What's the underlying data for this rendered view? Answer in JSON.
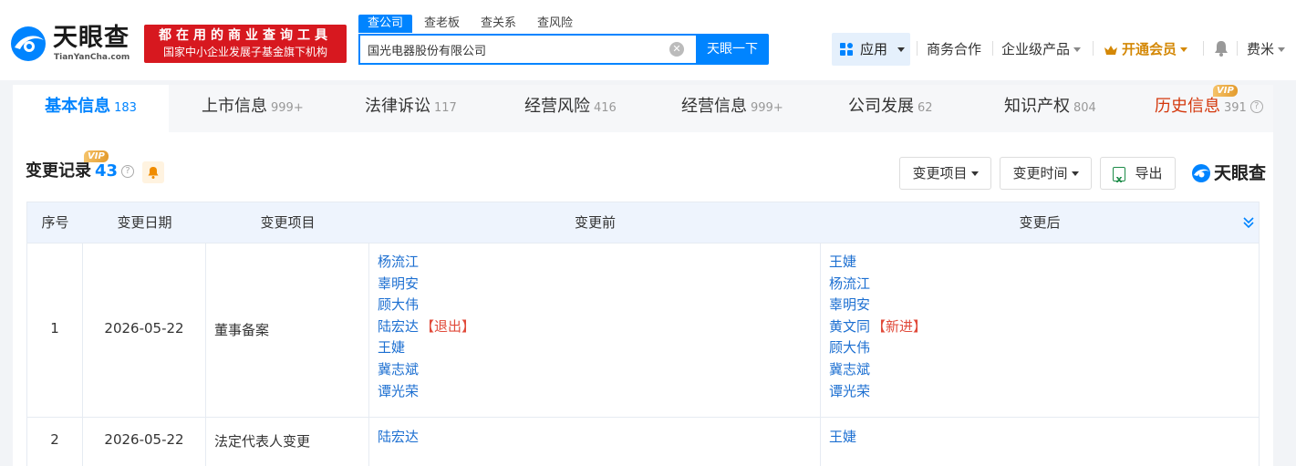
{
  "header": {
    "logo_cn": "天眼查",
    "logo_en": "TianYanCha.com",
    "slogan_line1": "都在用的商业查询工具",
    "slogan_line2": "国家中小企业发展子基金旗下机构",
    "search_tabs": [
      "查公司",
      "查老板",
      "查关系",
      "查风险"
    ],
    "search_value": "国光电器股份有限公司",
    "search_button": "天眼一下",
    "nav": {
      "apps": "应用",
      "business": "商务合作",
      "enterprise": "企业级产品",
      "vip": "开通会员",
      "user": "费米"
    }
  },
  "tabs": [
    {
      "label": "基本信息",
      "count": "183"
    },
    {
      "label": "上市信息",
      "count": "999+"
    },
    {
      "label": "法律诉讼",
      "count": "117"
    },
    {
      "label": "经营风险",
      "count": "416"
    },
    {
      "label": "经营信息",
      "count": "999+"
    },
    {
      "label": "公司发展",
      "count": "62"
    },
    {
      "label": "知识产权",
      "count": "804"
    },
    {
      "label": "历史信息",
      "count": "391"
    }
  ],
  "vip_label": "VIP",
  "section": {
    "title": "变更记录",
    "count": "43",
    "filter_item": "变更项目",
    "filter_time": "变更时间",
    "export": "导出",
    "brand": "天眼查"
  },
  "table": {
    "headers": [
      "序号",
      "变更日期",
      "变更项目",
      "变更前",
      "变更后"
    ],
    "rows": [
      {
        "index": "1",
        "date": "2026-05-22",
        "item": "董事备案",
        "before": [
          {
            "name": "杨流江",
            "tag": ""
          },
          {
            "name": "辜明安",
            "tag": ""
          },
          {
            "name": "顾大伟",
            "tag": ""
          },
          {
            "name": "陆宏达",
            "tag": "【退出】"
          },
          {
            "name": "王婕",
            "tag": ""
          },
          {
            "name": "冀志斌",
            "tag": ""
          },
          {
            "name": "谭光荣",
            "tag": ""
          }
        ],
        "after": [
          {
            "name": "王婕",
            "tag": ""
          },
          {
            "name": "杨流江",
            "tag": ""
          },
          {
            "name": "辜明安",
            "tag": ""
          },
          {
            "name": "黄文同",
            "tag": "【新进】"
          },
          {
            "name": "顾大伟",
            "tag": ""
          },
          {
            "name": "冀志斌",
            "tag": ""
          },
          {
            "name": "谭光荣",
            "tag": ""
          }
        ]
      },
      {
        "index": "2",
        "date": "2026-05-22",
        "item": "法定代表人变更",
        "before": [
          {
            "name": "陆宏达",
            "tag": ""
          }
        ],
        "after": [
          {
            "name": "王婕",
            "tag": ""
          }
        ]
      }
    ]
  }
}
